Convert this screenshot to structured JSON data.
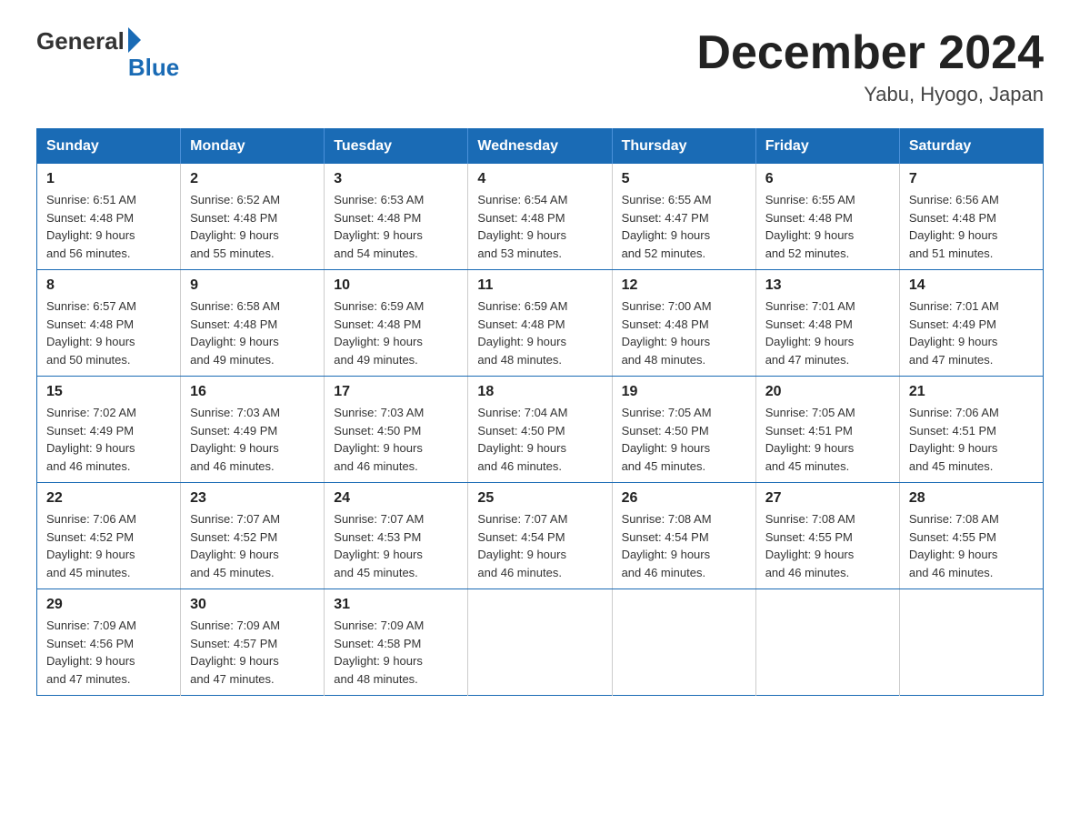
{
  "logo": {
    "general": "General",
    "blue": "Blue"
  },
  "title": "December 2024",
  "location": "Yabu, Hyogo, Japan",
  "days_of_week": [
    "Sunday",
    "Monday",
    "Tuesday",
    "Wednesday",
    "Thursday",
    "Friday",
    "Saturday"
  ],
  "weeks": [
    [
      {
        "day": "1",
        "sunrise": "6:51 AM",
        "sunset": "4:48 PM",
        "daylight": "9 hours and 56 minutes."
      },
      {
        "day": "2",
        "sunrise": "6:52 AM",
        "sunset": "4:48 PM",
        "daylight": "9 hours and 55 minutes."
      },
      {
        "day": "3",
        "sunrise": "6:53 AM",
        "sunset": "4:48 PM",
        "daylight": "9 hours and 54 minutes."
      },
      {
        "day": "4",
        "sunrise": "6:54 AM",
        "sunset": "4:48 PM",
        "daylight": "9 hours and 53 minutes."
      },
      {
        "day": "5",
        "sunrise": "6:55 AM",
        "sunset": "4:47 PM",
        "daylight": "9 hours and 52 minutes."
      },
      {
        "day": "6",
        "sunrise": "6:55 AM",
        "sunset": "4:48 PM",
        "daylight": "9 hours and 52 minutes."
      },
      {
        "day": "7",
        "sunrise": "6:56 AM",
        "sunset": "4:48 PM",
        "daylight": "9 hours and 51 minutes."
      }
    ],
    [
      {
        "day": "8",
        "sunrise": "6:57 AM",
        "sunset": "4:48 PM",
        "daylight": "9 hours and 50 minutes."
      },
      {
        "day": "9",
        "sunrise": "6:58 AM",
        "sunset": "4:48 PM",
        "daylight": "9 hours and 49 minutes."
      },
      {
        "day": "10",
        "sunrise": "6:59 AM",
        "sunset": "4:48 PM",
        "daylight": "9 hours and 49 minutes."
      },
      {
        "day": "11",
        "sunrise": "6:59 AM",
        "sunset": "4:48 PM",
        "daylight": "9 hours and 48 minutes."
      },
      {
        "day": "12",
        "sunrise": "7:00 AM",
        "sunset": "4:48 PM",
        "daylight": "9 hours and 48 minutes."
      },
      {
        "day": "13",
        "sunrise": "7:01 AM",
        "sunset": "4:48 PM",
        "daylight": "9 hours and 47 minutes."
      },
      {
        "day": "14",
        "sunrise": "7:01 AM",
        "sunset": "4:49 PM",
        "daylight": "9 hours and 47 minutes."
      }
    ],
    [
      {
        "day": "15",
        "sunrise": "7:02 AM",
        "sunset": "4:49 PM",
        "daylight": "9 hours and 46 minutes."
      },
      {
        "day": "16",
        "sunrise": "7:03 AM",
        "sunset": "4:49 PM",
        "daylight": "9 hours and 46 minutes."
      },
      {
        "day": "17",
        "sunrise": "7:03 AM",
        "sunset": "4:50 PM",
        "daylight": "9 hours and 46 minutes."
      },
      {
        "day": "18",
        "sunrise": "7:04 AM",
        "sunset": "4:50 PM",
        "daylight": "9 hours and 46 minutes."
      },
      {
        "day": "19",
        "sunrise": "7:05 AM",
        "sunset": "4:50 PM",
        "daylight": "9 hours and 45 minutes."
      },
      {
        "day": "20",
        "sunrise": "7:05 AM",
        "sunset": "4:51 PM",
        "daylight": "9 hours and 45 minutes."
      },
      {
        "day": "21",
        "sunrise": "7:06 AM",
        "sunset": "4:51 PM",
        "daylight": "9 hours and 45 minutes."
      }
    ],
    [
      {
        "day": "22",
        "sunrise": "7:06 AM",
        "sunset": "4:52 PM",
        "daylight": "9 hours and 45 minutes."
      },
      {
        "day": "23",
        "sunrise": "7:07 AM",
        "sunset": "4:52 PM",
        "daylight": "9 hours and 45 minutes."
      },
      {
        "day": "24",
        "sunrise": "7:07 AM",
        "sunset": "4:53 PM",
        "daylight": "9 hours and 45 minutes."
      },
      {
        "day": "25",
        "sunrise": "7:07 AM",
        "sunset": "4:54 PM",
        "daylight": "9 hours and 46 minutes."
      },
      {
        "day": "26",
        "sunrise": "7:08 AM",
        "sunset": "4:54 PM",
        "daylight": "9 hours and 46 minutes."
      },
      {
        "day": "27",
        "sunrise": "7:08 AM",
        "sunset": "4:55 PM",
        "daylight": "9 hours and 46 minutes."
      },
      {
        "day": "28",
        "sunrise": "7:08 AM",
        "sunset": "4:55 PM",
        "daylight": "9 hours and 46 minutes."
      }
    ],
    [
      {
        "day": "29",
        "sunrise": "7:09 AM",
        "sunset": "4:56 PM",
        "daylight": "9 hours and 47 minutes."
      },
      {
        "day": "30",
        "sunrise": "7:09 AM",
        "sunset": "4:57 PM",
        "daylight": "9 hours and 47 minutes."
      },
      {
        "day": "31",
        "sunrise": "7:09 AM",
        "sunset": "4:58 PM",
        "daylight": "9 hours and 48 minutes."
      },
      null,
      null,
      null,
      null
    ]
  ]
}
